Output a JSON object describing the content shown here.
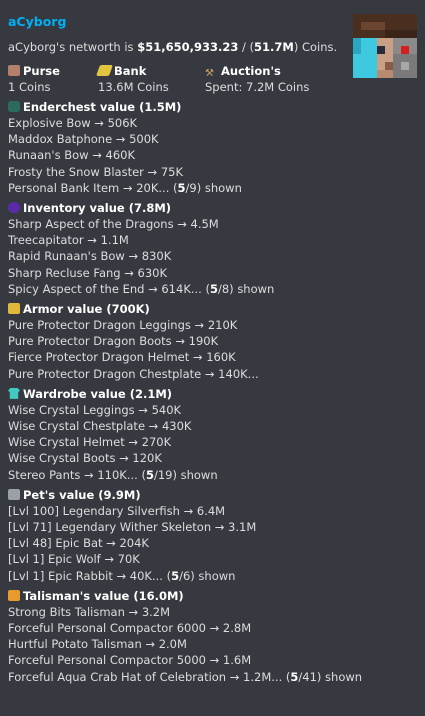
{
  "embed": {
    "title": "aCyborg",
    "desc_prefix": "aCyborg's networth is ",
    "networth": "$51,650,933.23",
    "desc_mid1": " / (",
    "networth_short": "51.7M",
    "desc_suffix": ") Coins."
  },
  "fields": [
    {
      "name": "Purse",
      "value": "1 Coins",
      "icon": "purse-icon"
    },
    {
      "name": "Bank",
      "value": "13.6M Coins",
      "icon": "gold-ingot-icon"
    },
    {
      "name": "Auction's",
      "value": "Spent: 7.2M Coins",
      "icon": "hammer-icon"
    }
  ],
  "sections": [
    {
      "key": "enderchest",
      "title": "Enderchest value (1.5M)",
      "icon": "ender-chest-icon",
      "items": [
        "Explosive Bow → 506K",
        "Maddox Batphone → 500K",
        "Runaan's Bow → 460K",
        "Frosty the Snow Blaster → 75K"
      ],
      "last_text": "Personal Bank Item → 20K... (",
      "shown": "5",
      "total": "/9) shown"
    },
    {
      "key": "inventory",
      "title": "Inventory value (7.8M)",
      "icon": "inventory-orb-icon",
      "items": [
        "Sharp Aspect of the Dragons → 4.5M",
        "Treecapitator → 1.1M",
        "Rapid Runaan's Bow → 830K",
        "Sharp Recluse Fang → 630K"
      ],
      "last_text": "Spicy Aspect of the End → 614K... (",
      "shown": "5",
      "total": "/8) shown"
    },
    {
      "key": "armor",
      "title": "Armor value (700K)",
      "icon": "armor-icon",
      "items": [
        "Pure Protector Dragon Leggings → 210K",
        "Pure Protector Dragon Boots → 190K",
        "Fierce Protector Dragon Helmet → 160K"
      ],
      "last_text": "Pure Protector Dragon Chestplate → 140K...",
      "shown": "",
      "total": ""
    },
    {
      "key": "wardrobe",
      "title": "Wardrobe value (2.1M)",
      "icon": "chestplate-icon",
      "items": [
        "Wise Crystal Leggings → 540K",
        "Wise Crystal Chestplate → 430K",
        "Wise Crystal Helmet → 270K",
        "Wise Crystal Boots → 120K"
      ],
      "last_text": "Stereo Pants → 110K... (",
      "shown": "5",
      "total": "/19) shown"
    },
    {
      "key": "pets",
      "title": "Pet's value (9.9M)",
      "icon": "pet-egg-icon",
      "items": [
        "[Lvl 100] Legendary Silverfish → 6.4M",
        "[Lvl 71] Legendary Wither Skeleton → 3.1M",
        "[Lvl 48] Epic Bat → 204K",
        "[Lvl 1] Epic Wolf → 70K"
      ],
      "last_text": "[Lvl 1] Epic Rabbit → 40K... (",
      "shown": "5",
      "total": "/6) shown"
    },
    {
      "key": "talisman",
      "title": "Talisman's value (16.0M)",
      "icon": "talisman-chest-icon",
      "items": [
        "Strong Bits Talisman → 3.2M",
        "Forceful Personal Compactor 6000 → 2.8M",
        "Hurtful Potato Talisman → 2.0M",
        "Forceful Personal Compactor 5000 → 1.6M"
      ],
      "last_text": "Forceful Aqua Crab Hat of Celebration → 1.2M... (",
      "shown": "5",
      "total": "/41) shown"
    }
  ]
}
